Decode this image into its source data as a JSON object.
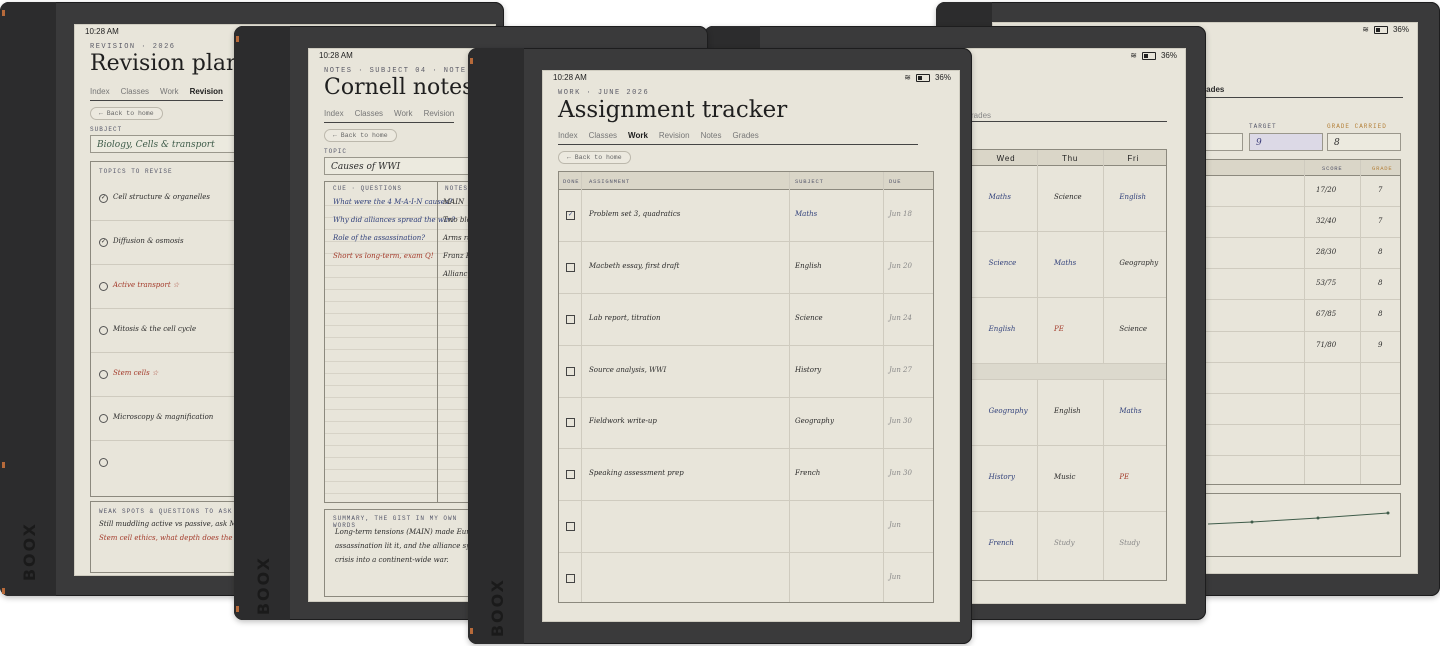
{
  "status": {
    "time": "10:28 AM",
    "battery": "36%"
  },
  "brand": "BOOX",
  "revision": {
    "eyebrow": "REVISION · 2026",
    "title": "Revision plann",
    "tabs": [
      "Index",
      "Classes",
      "Work",
      "Revision"
    ],
    "active_tab": "Revision",
    "back": "← Back to home",
    "subject_label": "SUBJECT",
    "subject_value": "Biology, Cells & transport",
    "topics_label": "TOPICS TO REVISE",
    "topics": [
      {
        "text": "Cell structure & organelles",
        "checked": true,
        "tone": "ink"
      },
      {
        "text": "Diffusion & osmosis",
        "checked": true,
        "tone": "ink"
      },
      {
        "text": "Active transport ☆",
        "checked": false,
        "tone": "red"
      },
      {
        "text": "Mitosis & the cell cycle",
        "checked": false,
        "tone": "ink"
      },
      {
        "text": "Stem cells ☆",
        "checked": false,
        "tone": "red"
      },
      {
        "text": "Microscopy & magnification",
        "checked": false,
        "tone": "ink"
      },
      {
        "text": "",
        "checked": false,
        "tone": "ink"
      }
    ],
    "weak_label": "WEAK SPOTS & QUESTIONS TO ASK",
    "weak_lines": [
      "Still muddling active vs passive, ask Mr Hale (r",
      "Stem cell ethics, what depth does the mark sc"
    ]
  },
  "cornell": {
    "eyebrow": "NOTES · SUBJECT 04 · NOTE 02",
    "title": "Cornell notes",
    "tabs": [
      "Index",
      "Classes",
      "Work",
      "Revision"
    ],
    "back": "← Back to home",
    "topic_label": "TOPIC",
    "topic_value": "Causes of WWI",
    "cue_label": "CUE · QUESTIONS",
    "notes_label": "NOTES",
    "cues": [
      {
        "text": "What were the 4 M-A-I-N causes?",
        "tone": "blue"
      },
      {
        "text": "Why did alliances spread the war?",
        "tone": "blue"
      },
      {
        "text": "Role of the assassination?",
        "tone": "blue"
      },
      {
        "text": "Short vs long-term, exam Q!",
        "tone": "red"
      }
    ],
    "notes": [
      "MAIN",
      "Two blo",
      "Arms ra",
      "Franz F",
      "Allianc"
    ],
    "summary_label": "SUMMARY, THE GIST IN MY OWN WORDS",
    "summary_lines": [
      "Long-term tensions (MAIN) made Europe a ti",
      "assassination lit it, and the alliance system tu",
      "crisis into a continent-wide war."
    ]
  },
  "tracker": {
    "eyebrow": "WORK · JUNE 2026",
    "title": "Assignment tracker",
    "tabs": [
      "Index",
      "Classes",
      "Work",
      "Revision",
      "Notes",
      "Grades"
    ],
    "active_tab": "Work",
    "back": "← Back to home",
    "headers": [
      "DONE",
      "ASSIGNMENT",
      "SUBJECT",
      "DUE"
    ],
    "rows": [
      {
        "done": true,
        "assignment": "Problem set 3, quadratics",
        "subject": "Maths",
        "due": "Jun 18",
        "subject_tone": "blue"
      },
      {
        "done": false,
        "assignment": "Macbeth essay, first draft",
        "subject": "English",
        "due": "Jun 20",
        "subject_tone": "ink"
      },
      {
        "done": false,
        "assignment": "Lab report, titration",
        "subject": "Science",
        "due": "Jun 24",
        "subject_tone": "ink"
      },
      {
        "done": false,
        "assignment": "Source analysis, WWI",
        "subject": "History",
        "due": "Jun 27",
        "subject_tone": "ink"
      },
      {
        "done": false,
        "assignment": "Fieldwork write-up",
        "subject": "Geography",
        "due": "Jun 30",
        "subject_tone": "ink"
      },
      {
        "done": false,
        "assignment": "Speaking assessment prep",
        "subject": "French",
        "due": "Jun 30",
        "subject_tone": "ink"
      },
      {
        "done": false,
        "assignment": "",
        "subject": "",
        "due": "Jun",
        "subject_tone": "ink"
      },
      {
        "done": false,
        "assignment": "",
        "subject": "",
        "due": "Jun",
        "subject_tone": "ink"
      }
    ]
  },
  "timetable": {
    "tab_fragment": "rades",
    "days": [
      "Wed",
      "Thu",
      "Fri"
    ],
    "rows": [
      [
        "Maths",
        "Science",
        "English"
      ],
      [
        "Science",
        "Maths",
        "Geography"
      ],
      [
        "English",
        "PE",
        "Science"
      ],
      [
        "Geography",
        "English",
        "Maths"
      ],
      [
        "History",
        "Music",
        "PE"
      ],
      [
        "French",
        "Study",
        "Study"
      ]
    ]
  },
  "grades": {
    "tab_fragment": "rades",
    "target_label": "TARGET",
    "target_value": "9",
    "carried_label": "GRADE CARRIED",
    "carried_value": "8",
    "score_label": "SCORE",
    "grade_label": "GRADE",
    "rows": [
      {
        "score": "17/20",
        "grade": "7"
      },
      {
        "score": "32/40",
        "grade": "7"
      },
      {
        "score": "28/30",
        "grade": "8"
      },
      {
        "score": "53/75",
        "grade": "8"
      },
      {
        "score": "67/85",
        "grade": "8"
      },
      {
        "score": "71/80",
        "grade": "9"
      },
      {
        "score": "",
        "grade": ""
      },
      {
        "score": "",
        "grade": ""
      },
      {
        "score": "",
        "grade": ""
      },
      {
        "score": "",
        "grade": ""
      }
    ]
  }
}
